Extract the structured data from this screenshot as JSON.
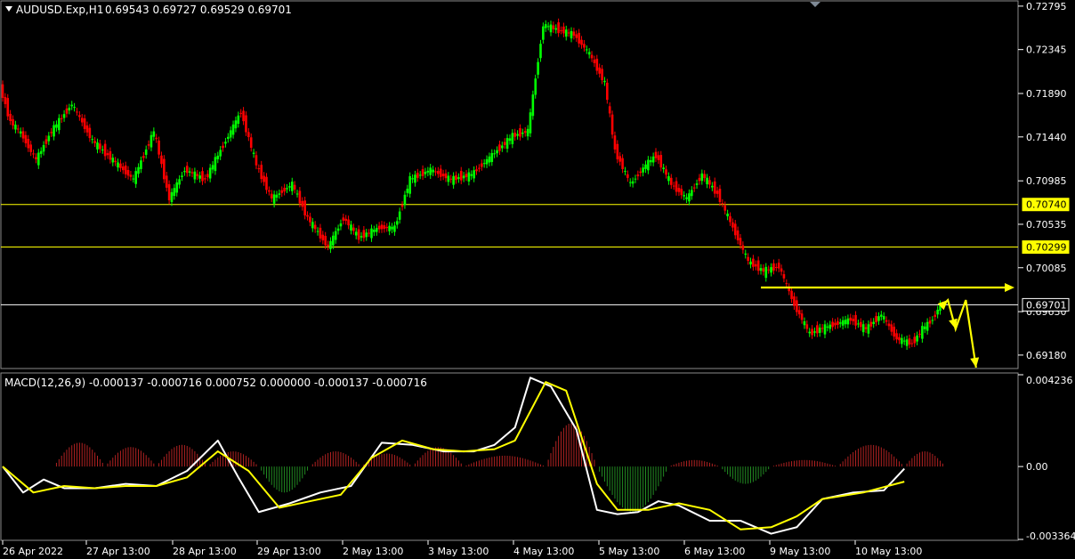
{
  "header": {
    "symbol_label": "AUDUSD.Exp,H1",
    "ohlc_label": "0.69543 0.69727 0.69529 0.69701"
  },
  "macd": {
    "label": "MACD(12,26,9) -0.000137 -0.000716 0.000752 0.000000 -0.000137 -0.000716",
    "y_ticks": [
      "0.004236",
      "0.00",
      "-0.003364"
    ]
  },
  "price_axis": {
    "ticks": [
      "0.72795",
      "0.72345",
      "0.71890",
      "0.71440",
      "0.70985",
      "0.70535",
      "0.70085",
      "0.69630",
      "0.69180"
    ]
  },
  "x_axis": {
    "labels": [
      "26 Apr 2022",
      "27 Apr 13:00",
      "28 Apr 13:00",
      "29 Apr 13:00",
      "2 May 13:00",
      "3 May 13:00",
      "4 May 13:00",
      "5 May 13:00",
      "6 May 13:00",
      "9 May 13:00",
      "10 May 13:00"
    ]
  },
  "levels": [
    {
      "value": "0.70740",
      "color": "#ffff00"
    },
    {
      "value": "0.70299",
      "color": "#ffff00"
    },
    {
      "value": "0.69701",
      "color": "#ffffff"
    }
  ],
  "colors": {
    "background": "#000000",
    "bull": "#00ff00",
    "bear": "#ff0000",
    "level_line": "#ffff00",
    "arrow": "#ffff00",
    "macd_line": "#ffffff",
    "signal_line": "#ffff00",
    "hist_pos": "#b22222",
    "hist_neg": "#228b22"
  },
  "chart_data": {
    "type": "line",
    "title": "AUDUSD.Exp,H1",
    "x_labels": [
      "26 Apr 2022",
      "27 Apr 13:00",
      "28 Apr 13:00",
      "29 Apr 13:00",
      "2 May 13:00",
      "3 May 13:00",
      "4 May 13:00",
      "5 May 13:00",
      "6 May 13:00",
      "9 May 13:00",
      "10 May 13:00"
    ],
    "price_ylim": [
      0.6905,
      0.7284
    ],
    "price_path": [
      [
        0,
        0.7195
      ],
      [
        4,
        0.716
      ],
      [
        8,
        0.7148
      ],
      [
        14,
        0.712
      ],
      [
        20,
        0.715
      ],
      [
        28,
        0.7178
      ],
      [
        36,
        0.714
      ],
      [
        44,
        0.712
      ],
      [
        52,
        0.71
      ],
      [
        60,
        0.715
      ],
      [
        66,
        0.708
      ],
      [
        72,
        0.711
      ],
      [
        80,
        0.71
      ],
      [
        88,
        0.714
      ],
      [
        94,
        0.717
      ],
      [
        100,
        0.7115
      ],
      [
        106,
        0.708
      ],
      [
        114,
        0.7095
      ],
      [
        120,
        0.706
      ],
      [
        128,
        0.703
      ],
      [
        134,
        0.706
      ],
      [
        140,
        0.704
      ],
      [
        148,
        0.705
      ],
      [
        154,
        0.705
      ],
      [
        160,
        0.71
      ],
      [
        168,
        0.711
      ],
      [
        176,
        0.71
      ],
      [
        184,
        0.7105
      ],
      [
        192,
        0.7125
      ],
      [
        200,
        0.7145
      ],
      [
        206,
        0.715
      ],
      [
        212,
        0.726
      ],
      [
        218,
        0.7255
      ],
      [
        224,
        0.725
      ],
      [
        230,
        0.723
      ],
      [
        236,
        0.72
      ],
      [
        240,
        0.713
      ],
      [
        246,
        0.7095
      ],
      [
        252,
        0.7115
      ],
      [
        256,
        0.7125
      ],
      [
        262,
        0.7095
      ],
      [
        268,
        0.708
      ],
      [
        274,
        0.7105
      ],
      [
        280,
        0.7085
      ],
      [
        286,
        0.705
      ],
      [
        292,
        0.7015
      ],
      [
        298,
        0.7005
      ],
      [
        304,
        0.701
      ],
      [
        310,
        0.697
      ],
      [
        316,
        0.694
      ],
      [
        320,
        0.6945
      ],
      [
        326,
        0.695
      ],
      [
        332,
        0.6955
      ],
      [
        338,
        0.6945
      ],
      [
        344,
        0.696
      ],
      [
        350,
        0.6935
      ],
      [
        356,
        0.693
      ],
      [
        360,
        0.6945
      ],
      [
        364,
        0.6955
      ],
      [
        367,
        0.697
      ]
    ],
    "projection_path": [
      [
        367,
        0.697
      ],
      [
        369,
        0.6975
      ],
      [
        372,
        0.6945
      ],
      [
        376,
        0.6975
      ],
      [
        380,
        0.6905
      ]
    ],
    "resistance_arrow": {
      "from": [
        296,
        0.6988
      ],
      "to": [
        395,
        0.6988
      ]
    },
    "macd_ylim": [
      -0.003364,
      0.004236
    ],
    "macd_series": [
      {
        "values": [
          [
            0,
            0.0
          ],
          [
            8,
            -0.0012
          ],
          [
            16,
            -0.0006
          ],
          [
            24,
            -0.001
          ],
          [
            36,
            -0.001
          ],
          [
            48,
            -0.0008
          ],
          [
            60,
            -0.0009
          ],
          [
            72,
            -0.0002
          ],
          [
            84,
            0.0012
          ],
          [
            92,
            -0.0005
          ],
          [
            100,
            -0.0021
          ],
          [
            112,
            -0.0017
          ],
          [
            124,
            -0.0012
          ],
          [
            136,
            -0.0009
          ],
          [
            148,
            0.0011
          ],
          [
            160,
            0.001
          ],
          [
            172,
            0.0007
          ],
          [
            184,
            0.0007
          ],
          [
            192,
            0.001
          ],
          [
            200,
            0.0018
          ],
          [
            206,
            0.0041
          ],
          [
            214,
            0.0037
          ],
          [
            224,
            0.0017
          ],
          [
            232,
            -0.002
          ],
          [
            240,
            -0.0022
          ],
          [
            248,
            -0.0021
          ],
          [
            256,
            -0.0016
          ],
          [
            264,
            -0.0018
          ],
          [
            276,
            -0.0025
          ],
          [
            288,
            -0.0025
          ],
          [
            300,
            -0.0031
          ],
          [
            310,
            -0.0028
          ],
          [
            320,
            -0.0015
          ],
          [
            332,
            -0.0012
          ],
          [
            344,
            -0.0011
          ],
          [
            352,
            -0.0001
          ]
        ]
      },
      {
        "values": [
          [
            0,
            0.0
          ],
          [
            12,
            -0.0012
          ],
          [
            24,
            -0.0009
          ],
          [
            36,
            -0.001
          ],
          [
            48,
            -0.0009
          ],
          [
            60,
            -0.0009
          ],
          [
            72,
            -0.0005
          ],
          [
            84,
            0.0007
          ],
          [
            96,
            -0.0002
          ],
          [
            108,
            -0.0019
          ],
          [
            120,
            -0.0016
          ],
          [
            132,
            -0.0013
          ],
          [
            144,
            0.0004
          ],
          [
            156,
            0.0012
          ],
          [
            168,
            0.0008
          ],
          [
            180,
            0.0007
          ],
          [
            192,
            0.0008
          ],
          [
            200,
            0.0012
          ],
          [
            212,
            0.0039
          ],
          [
            220,
            0.0035
          ],
          [
            232,
            -0.0008
          ],
          [
            240,
            -0.002
          ],
          [
            252,
            -0.002
          ],
          [
            264,
            -0.0017
          ],
          [
            276,
            -0.002
          ],
          [
            288,
            -0.0029
          ],
          [
            300,
            -0.0028
          ],
          [
            310,
            -0.0023
          ],
          [
            320,
            -0.0015
          ],
          [
            336,
            -0.0012
          ],
          [
            352,
            -0.0007
          ]
        ]
      }
    ],
    "macd_histogram": [
      [
        20,
        0.0011
      ],
      [
        40,
        0.0009
      ],
      [
        60,
        0.001
      ],
      [
        80,
        0.0007
      ],
      [
        100,
        -0.0012
      ],
      [
        120,
        0.0007
      ],
      [
        140,
        0.0006
      ],
      [
        160,
        0.0009
      ],
      [
        180,
        0.0005
      ],
      [
        212,
        0.002
      ],
      [
        232,
        -0.0021
      ],
      [
        260,
        0.0003
      ],
      [
        280,
        -0.0008
      ],
      [
        300,
        0.0003
      ],
      [
        326,
        0.001
      ],
      [
        352,
        0.0007
      ]
    ],
    "grid": false
  }
}
